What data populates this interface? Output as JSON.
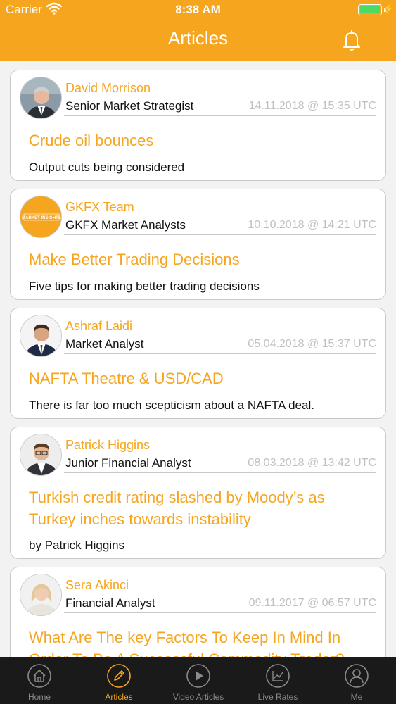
{
  "status_bar": {
    "carrier": "Carrier",
    "time": "8:38 AM"
  },
  "nav": {
    "title": "Articles"
  },
  "articles": [
    {
      "author": "David Morrison",
      "role": "Senior Market Strategist",
      "date": "14.11.2018 @ 15:35 UTC",
      "title": "Crude oil bounces",
      "summary": "Output cuts being considered"
    },
    {
      "author": "GKFX Team",
      "role": "GKFX Market Analysts",
      "date": "10.10.2018 @ 14:21 UTC",
      "title": "Make Better Trading Decisions",
      "summary": "Five tips for making better trading decisions",
      "logo_text": "MARKET INSIGHTS"
    },
    {
      "author": "Ashraf Laidi",
      "role": "Market Analyst",
      "date": "05.04.2018 @ 15:37 UTC",
      "title": "NAFTA Theatre & USD/CAD",
      "summary": "There is far too much scepticism about a NAFTA deal."
    },
    {
      "author": "Patrick Higgins",
      "role": "Junior Financial Analyst",
      "date": "08.03.2018 @ 13:42 UTC",
      "title": "Turkish credit rating slashed by Moody’s as Turkey inches towards instability",
      "summary": "by Patrick Higgins"
    },
    {
      "author": "Sera Akinci",
      "role": "Financial Analyst",
      "date": "09.11.2017 @ 06:57 UTC",
      "title": "What Are The key Factors To Keep In Mind In Order To Be A Successful Commodity Trader?",
      "summary": ""
    }
  ],
  "tabs": [
    {
      "label": "Home",
      "icon": "home-icon",
      "active": false
    },
    {
      "label": "Articles",
      "icon": "pencil-icon",
      "active": true
    },
    {
      "label": "Video Articles",
      "icon": "play-icon",
      "active": false
    },
    {
      "label": "Live Rates",
      "icon": "chart-icon",
      "active": false
    },
    {
      "label": "Me",
      "icon": "user-icon",
      "active": false
    }
  ],
  "colors": {
    "accent": "#f6a51f",
    "tabbar": "#1a1a1a",
    "battery": "#4cd964"
  }
}
